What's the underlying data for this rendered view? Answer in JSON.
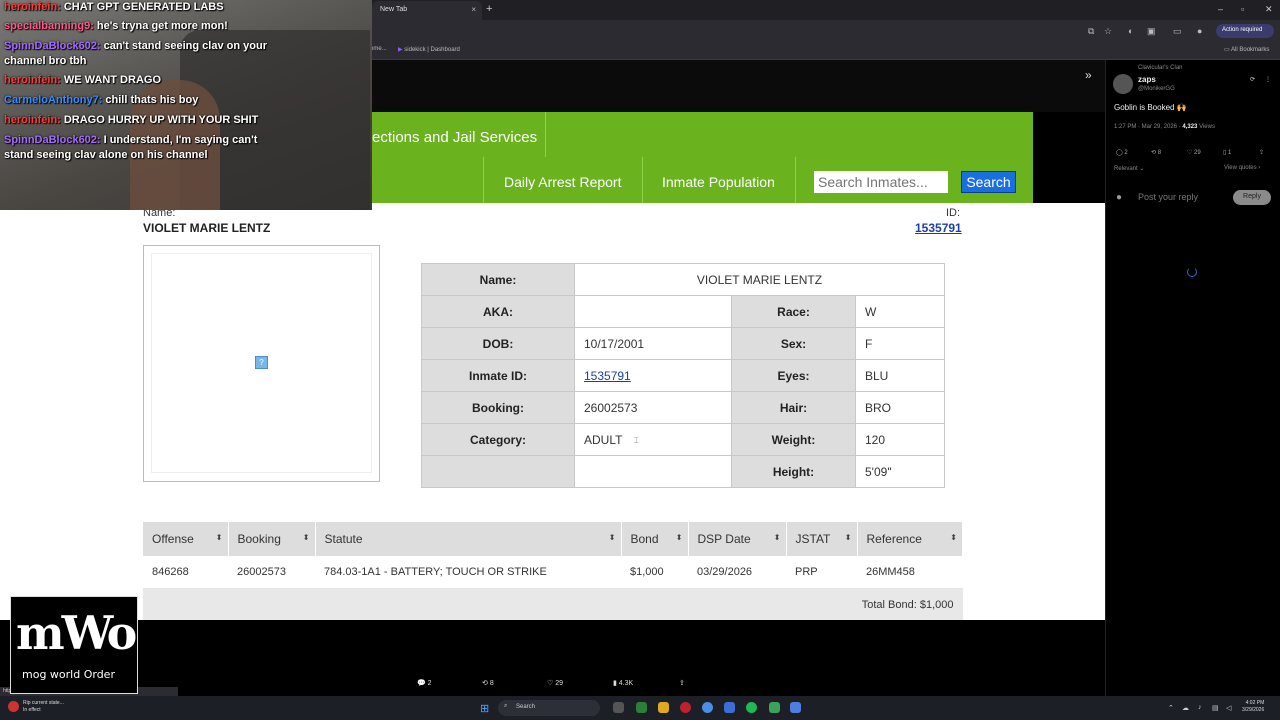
{
  "browser": {
    "tab_title": "New Tab",
    "tab_close": "×",
    "tab_add": "+",
    "action_required": "Action required",
    "bookmarks": [
      "ome...",
      "sidekick | Dashboard"
    ],
    "all_bookmarks": "All Bookmarks",
    "status_url": "https://x.com/.../status/.../photo/1"
  },
  "jail_site": {
    "title": "ections and Jail Services",
    "nav": [
      "Daily Arrest Report",
      "Inmate Population"
    ],
    "search_placeholder": "Search Inmates...",
    "search_button": "Search"
  },
  "inmate": {
    "name_label": "Name:",
    "name": "VIOLET MARIE LENTZ",
    "id_label": "ID:",
    "id": "1535791",
    "photo_placeholder": "?",
    "details": {
      "name_label": "Name:",
      "name": "VIOLET MARIE LENTZ",
      "aka_label": "AKA:",
      "aka": "",
      "race_label": "Race:",
      "race": "W",
      "dob_label": "DOB:",
      "dob": "10/17/2001",
      "sex_label": "Sex:",
      "sex": "F",
      "inmate_id_label": "Inmate ID:",
      "inmate_id": "1535791",
      "eyes_label": "Eyes:",
      "eyes": "BLU",
      "booking_label": "Booking:",
      "booking": "26002573",
      "hair_label": "Hair:",
      "hair": "BRO",
      "category_label": "Category:",
      "category": "ADULT",
      "weight_label": "Weight:",
      "weight": "120",
      "height_label": "Height:",
      "height": "5'09\""
    }
  },
  "charges": {
    "headers": [
      "Offense",
      "Booking",
      "Statute",
      "Bond",
      "DSP Date",
      "JSTAT",
      "Reference"
    ],
    "sort_glyph": "⬍",
    "rows": [
      [
        "846268",
        "26002573",
        "784.03-1A1 - BATTERY; TOUCH OR STRIKE",
        "$1,000",
        "03/29/2026",
        "PRP",
        "26MM458"
      ]
    ],
    "total": "Total Bond: $1,000"
  },
  "x_post": {
    "community": "Clavicular's Clan",
    "display_name": "zaps",
    "handle": "@MonikerGG",
    "text": "Goblin is Booked 🙌",
    "meta": "1:27 PM · Mar 29, 2026 ·",
    "views_count": "4,323",
    "views_label": "Views",
    "counts": [
      "2",
      "8",
      "29",
      "1"
    ],
    "relevant": "Relevant ⌄",
    "view_quotes": "View quotes ›",
    "reply_placeholder": "Post your reply",
    "reply_button": "Reply"
  },
  "video_bar": {
    "replies": "2",
    "reposts": "8",
    "likes": "29",
    "views": "4.3K"
  },
  "chat": [
    {
      "user": "heroinfein:",
      "text": "CHAT GPT GENERATED LABS",
      "color": "#ff3b3b"
    },
    {
      "user": "specialbanning9:",
      "text": "he's tryna get more mon!",
      "color": "#ff5a8a"
    },
    {
      "user": "SpinnDaBlock602:",
      "text": "can't stand seeing clav on your",
      "color": "#a56bff"
    },
    {
      "user": "",
      "text": "channel bro tbh",
      "color": "#ffffff"
    },
    {
      "user": "heroinfein:",
      "text": "WE WANT DRAGO",
      "color": "#ff3b3b"
    },
    {
      "user": "CarmeloAnthony7:",
      "text": "chill thats his boy",
      "color": "#3b8cff"
    },
    {
      "user": "heroinfein:",
      "text": "DRAGO HURRY UP WITH YOUR SHIT",
      "color": "#ff3b3b"
    },
    {
      "user": "SpinnDaBlock602:",
      "text": "I understand, I'm saying can't",
      "color": "#a56bff"
    },
    {
      "user": "",
      "text": "stand seeing clav alone on his channel",
      "color": "#ffffff"
    }
  ],
  "logo": {
    "big": "mWo",
    "sub": "mog world Order"
  },
  "taskbar": {
    "news_title": "Rip current state...",
    "news_sub": "In effect",
    "search": "Search",
    "time": "4:02 PM",
    "date": "3/29/2026"
  }
}
